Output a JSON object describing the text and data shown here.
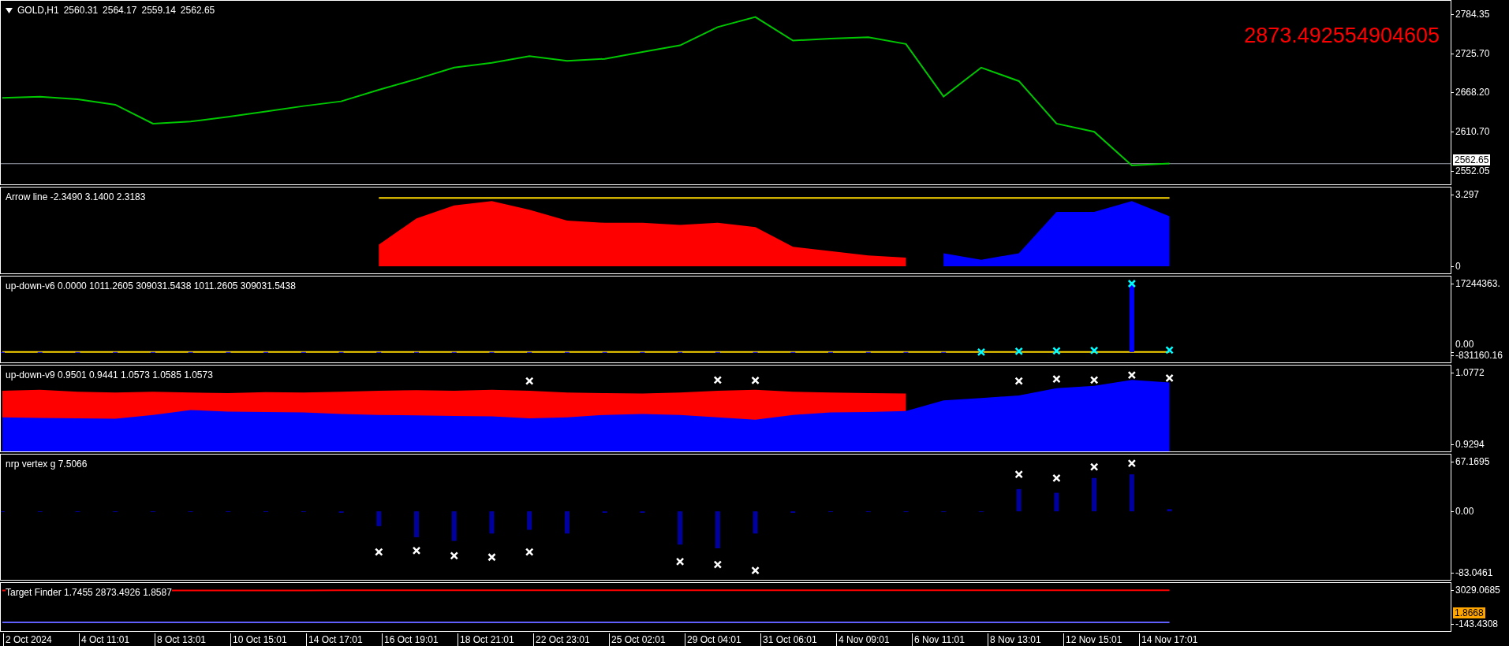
{
  "main": {
    "symbol": "GOLD,H1",
    "ohlc": [
      "2560.31",
      "2564.17",
      "2559.14",
      "2562.65"
    ],
    "overlay_value": "2873.492554904605",
    "badge": {
      "kind": "current_price",
      "text": "2562.65"
    },
    "axis_labels": [
      "2784.35",
      "2725.70",
      "2668.20",
      "2610.70",
      "2552.05"
    ]
  },
  "panes": [
    {
      "title": "Arrow line -2.3490 3.1400 2.3183",
      "axis_labels": [
        "3.297",
        "0"
      ]
    },
    {
      "title": "up-down-v6 0.0000 1011.2605 309031.5438 1011.2605 309031.5438",
      "axis_labels": [
        "17244363.",
        "0.00",
        "-831160.16"
      ]
    },
    {
      "title": "up-down-v9 0.9501 0.9441 1.0573 1.0585 1.0573",
      "axis_labels": [
        "1.0772",
        "0.9294"
      ]
    },
    {
      "title": "nrp vertex g 7.5066",
      "axis_labels": [
        "67.1695",
        "0.00",
        "-83.0461"
      ]
    },
    {
      "title": "Target Finder 1.7455 2873.4926 1.8587",
      "badge": {
        "kind": "indicator_value",
        "text": "1.8668"
      },
      "axis_labels": [
        "3029.0685",
        "-143.4308"
      ]
    }
  ],
  "time_axis": [
    "2 Oct 2024",
    "4 Oct 11:01",
    "8 Oct 13:01",
    "10 Oct 15:01",
    "14 Oct 17:01",
    "16 Oct 19:01",
    "18 Oct 21:01",
    "22 Oct 23:01",
    "25 Oct 02:01",
    "29 Oct 04:01",
    "31 Oct 06:01",
    "4 Nov 09:01",
    "6 Nov 11:01",
    "8 Nov 13:01",
    "12 Nov 15:01",
    "14 Nov 17:01"
  ]
}
